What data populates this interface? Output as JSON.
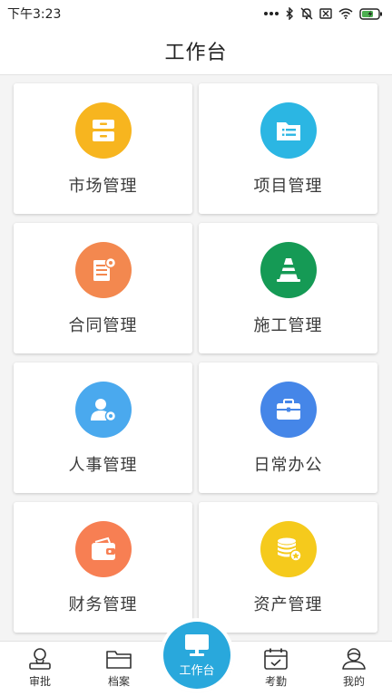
{
  "status_bar": {
    "time": "下午3:23",
    "icons": [
      "more-dots-icon",
      "bluetooth-icon",
      "mute-icon",
      "sim-icon",
      "wifi-icon",
      "battery-charging-icon"
    ]
  },
  "header": {
    "title": "工作台"
  },
  "tiles": [
    {
      "label": "市场管理",
      "icon": "cabinet-icon",
      "color": "#f7b51f"
    },
    {
      "label": "项目管理",
      "icon": "folder-list-icon",
      "color": "#2bb6e3"
    },
    {
      "label": "合同管理",
      "icon": "contract-gear-icon",
      "color": "#f3884f"
    },
    {
      "label": "施工管理",
      "icon": "traffic-cone-icon",
      "color": "#159a55"
    },
    {
      "label": "人事管理",
      "icon": "user-gear-icon",
      "color": "#4aa9ee"
    },
    {
      "label": "日常办公",
      "icon": "briefcase-icon",
      "color": "#4586e8"
    },
    {
      "label": "财务管理",
      "icon": "wallet-icon",
      "color": "#f77f53"
    },
    {
      "label": "资产管理",
      "icon": "coins-icon",
      "color": "#f5ca1c"
    }
  ],
  "tab_bar": {
    "items": [
      {
        "label": "审批",
        "icon": "approval-icon"
      },
      {
        "label": "档案",
        "icon": "archive-folder-icon"
      },
      {
        "label": "工作台",
        "icon": "monitor-icon",
        "active": true
      },
      {
        "label": "考勤",
        "icon": "calendar-check-icon"
      },
      {
        "label": "我的",
        "icon": "profile-icon"
      }
    ],
    "active_color": "#29a8dc"
  }
}
